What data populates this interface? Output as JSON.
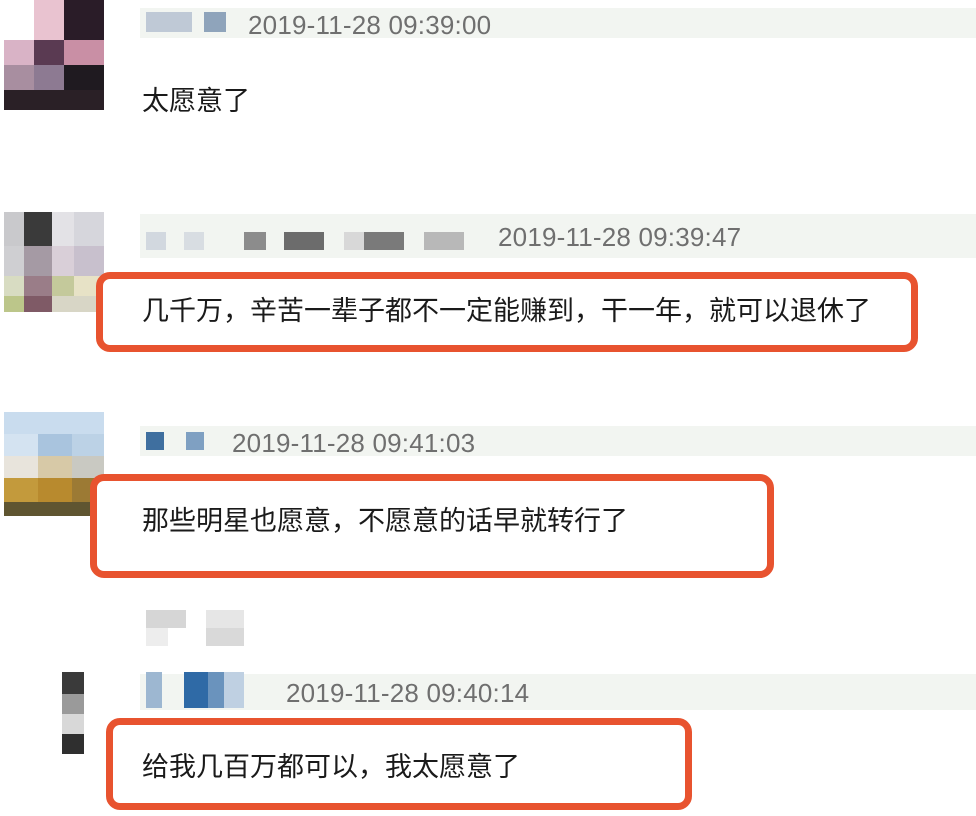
{
  "comments": [
    {
      "timestamp": "2019-11-28 09:39:00",
      "text": "太愿意了",
      "highlighted": false
    },
    {
      "timestamp": "2019-11-28 09:39:47",
      "text": "几千万，辛苦一辈子都不一定能赚到，干一年，就可以退休了",
      "highlighted": true
    },
    {
      "timestamp": "2019-11-28 09:41:03",
      "text": "那些明星也愿意，不愿意的话早就转行了",
      "highlighted": true
    },
    {
      "timestamp": "2019-11-28 09:40:14",
      "text": "给我几百万都可以，我太愿意了",
      "highlighted": true,
      "is_reply": true
    }
  ],
  "colors": {
    "highlight_border": "#e8532f",
    "name_band": "#f2f5f1",
    "timestamp": "#6f6f6f",
    "text": "#1a1a1a"
  }
}
